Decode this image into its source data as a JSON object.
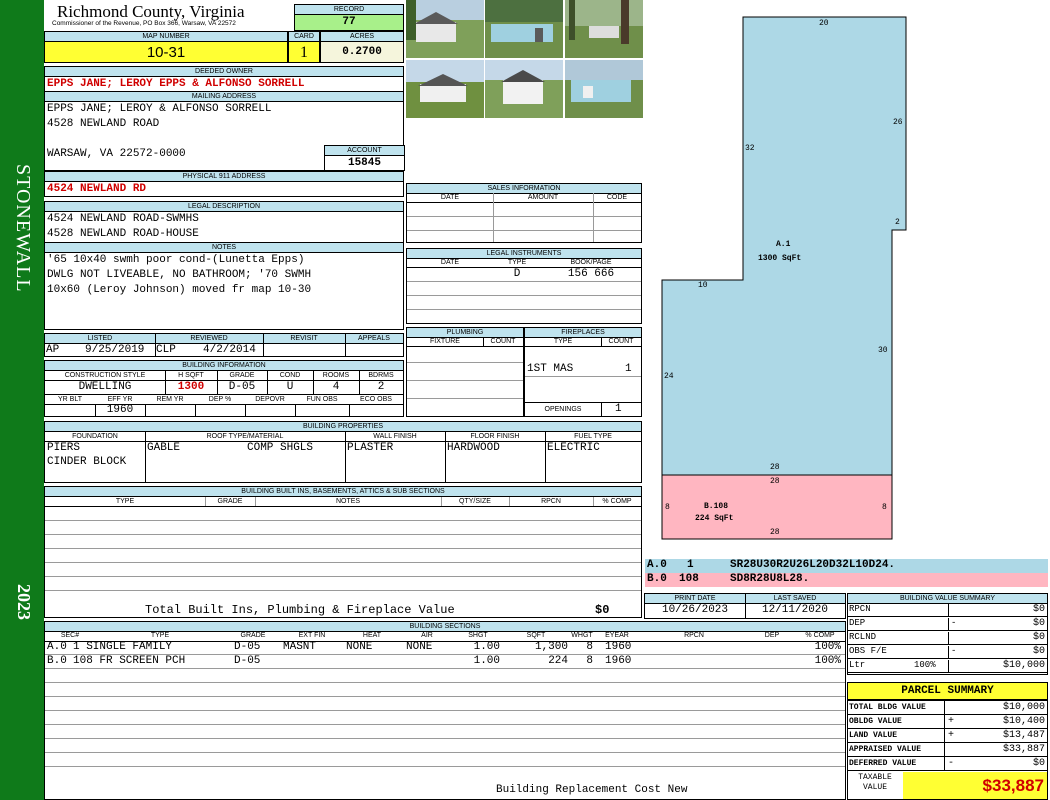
{
  "sidebar": {
    "name": "STONEWALL",
    "year": "2023"
  },
  "header": {
    "county": "Richmond County, Virginia",
    "commissioner": "Commissioner of the Revenue, PO Box 366, Warsaw, VA 22572",
    "record_label": "RECORD",
    "record": "77",
    "map_label": "MAP NUMBER",
    "map_number": "10-31",
    "card_label": "CARD",
    "card": "1",
    "acres_label": "ACRES",
    "acres": "0.2700"
  },
  "owner": {
    "deeded_label": "DEEDED OWNER",
    "deeded": "EPPS JANE; LEROY EPPS & ALFONSO SORRELL",
    "mailing_label": "MAILING ADDRESS",
    "mailing": [
      "EPPS JANE; LEROY & ALFONSO SORRELL",
      "4528 NEWLAND ROAD",
      "",
      "WARSAW, VA 22572-0000"
    ],
    "account_label": "ACCOUNT",
    "account": "15845",
    "physical_label": "PHYSICAL 911 ADDRESS",
    "physical": "4524 NEWLAND RD"
  },
  "legal": {
    "label": "LEGAL DESCRIPTION",
    "lines": [
      "4524 NEWLAND ROAD-SWMHS",
      "4528 NEWLAND ROAD-HOUSE"
    ]
  },
  "notes": {
    "label": "NOTES",
    "lines": [
      "'65 10x40 swmh poor cond-(Lunetta Epps)",
      "DWLG NOT LIVEABLE, NO BATHROOM; '70 SWMH",
      "10x60 (Leroy Johnson) moved fr map 10-30"
    ]
  },
  "review": {
    "listed_label": "LISTED",
    "reviewed_label": "REVIEWED",
    "revisit_label": "REVISIT",
    "appeals_label": "APPEALS",
    "listed_by": "AP",
    "listed_date": "9/25/2019",
    "reviewed_by": "CLP",
    "reviewed_date": "4/2/2014"
  },
  "building_info": {
    "label": "BUILDING INFORMATION",
    "headers": [
      "CONSTRUCTION STYLE",
      "H SQFT",
      "GRADE",
      "COND",
      "ROOMS",
      "BDRMS"
    ],
    "style": "DWELLING",
    "hsqft": "1300",
    "grade": "D-05",
    "cond": "U",
    "rooms": "4",
    "bdrms": "2",
    "headers2": [
      "YR BLT",
      "EFF YR",
      "REM YR",
      "DEP %",
      "DEPOVR",
      "FUN OBS",
      "ECO OBS"
    ],
    "eff_yr": "1960"
  },
  "sales": {
    "label": "SALES INFORMATION",
    "headers": [
      "DATE",
      "AMOUNT",
      "CODE"
    ]
  },
  "instruments": {
    "label": "LEGAL INSTRUMENTS",
    "headers": [
      "DATE",
      "TYPE",
      "BOOK/PAGE"
    ],
    "type": "D",
    "bookpage": "156 666"
  },
  "plumbing": {
    "label": "PLUMBING",
    "headers": [
      "FIXTURE",
      "COUNT"
    ]
  },
  "fireplaces": {
    "label": "FIREPLACES",
    "headers": [
      "TYPE",
      "COUNT"
    ],
    "type": "1ST MAS",
    "count": "1",
    "openings_label": "OPENINGS",
    "openings": "1"
  },
  "properties": {
    "label": "BUILDING PROPERTIES",
    "headers": [
      "FOUNDATION",
      "ROOF TYPE/MATERIAL",
      "WALL FINISH",
      "FLOOR FINISH",
      "FUEL TYPE"
    ],
    "foundation": [
      "PIERS",
      "CINDER BLOCK"
    ],
    "roof_type": "GABLE",
    "roof_material": "COMP SHGLS",
    "wall": "PLASTER",
    "floor": "HARDWOOD",
    "fuel": "ELECTRIC"
  },
  "builtins": {
    "label": "BUILDING BUILT INS, BASEMENTS, ATTICS & SUB SECTIONS",
    "headers": [
      "TYPE",
      "GRADE",
      "NOTES",
      "QTY/SIZE",
      "RPCN",
      "% COMP"
    ],
    "total_label": "Total Built Ins, Plumbing & Fireplace Value",
    "total": "$0"
  },
  "sketch": {
    "a_label": "A.1",
    "a_area": "1300 SqFt",
    "b_label": "B.108",
    "b_area": "224 SqFt",
    "dims": {
      "top": "20",
      "right_upper": "26",
      "left_upper": "32",
      "notch": "2",
      "step": "10",
      "right_lower": "30",
      "left_lower": "24",
      "mid": "28",
      "b_top": "28",
      "b_left": "8",
      "b_right": "8",
      "b_bottom": "28"
    },
    "codes": [
      {
        "id": "A.0",
        "n": "1",
        "code": "SR28U30R2U26L20D32L10D24."
      },
      {
        "id": "B.0",
        "n": "108",
        "code": "SD8R28U8L28."
      }
    ]
  },
  "dates": {
    "print_label": "PRINT DATE",
    "print": "10/26/2023",
    "saved_label": "LAST SAVED",
    "saved": "12/11/2020"
  },
  "value_summary": {
    "label": "BUILDING VALUE SUMMARY",
    "rows": [
      {
        "label": "RPCN",
        "sign": "",
        "value": "$0"
      },
      {
        "label": "DEP",
        "sign": "-",
        "value": "$0"
      },
      {
        "label": "RCLND",
        "sign": "",
        "value": "$0"
      },
      {
        "label": "OBS F/E",
        "sign": "-",
        "value": "$0"
      },
      {
        "label": "Ltr",
        "sign": "100%",
        "value": "$10,000"
      }
    ]
  },
  "parcel_summary": {
    "label": "PARCEL SUMMARY",
    "rows": [
      {
        "label": "TOTAL BLDG VALUE",
        "sign": "",
        "value": "$10,000"
      },
      {
        "label": "OBLDG VALUE",
        "sign": "+",
        "value": "$10,400"
      },
      {
        "label": "LAND VALUE",
        "sign": "+",
        "value": "$13,487"
      },
      {
        "label": "APPRAISED VALUE",
        "sign": "",
        "value": "$33,887"
      },
      {
        "label": "DEFERRED VALUE",
        "sign": "-",
        "value": "$0"
      }
    ],
    "taxable_label1": "TAXABLE",
    "taxable_label2": "VALUE",
    "taxable": "$33,887"
  },
  "sections": {
    "label": "BUILDING SECTIONS",
    "headers": [
      "SEC#",
      "TYPE",
      "GRADE",
      "EXT FIN",
      "HEAT",
      "AIR",
      "SHGT",
      "SQFT",
      "WHGT",
      "EYEAR",
      "RPCN",
      "DEP",
      "% COMP"
    ],
    "rows": [
      {
        "sec": "A.0",
        "type": "1 SINGLE FAMILY",
        "grade": "D-05",
        "ext": "MASNT",
        "heat": "NONE",
        "air": "NONE",
        "shgt": "1.00",
        "sqft": "1,300",
        "whgt": "8",
        "eyear": "1960",
        "comp": "100%"
      },
      {
        "sec": "B.0",
        "type": "108 FR SCREEN PCH",
        "grade": "D-05",
        "ext": "",
        "heat": "",
        "air": "",
        "shgt": "1.00",
        "sqft": "224",
        "whgt": "8",
        "eyear": "1960",
        "comp": "100%"
      }
    ],
    "footer": "Building Replacement Cost New"
  },
  "colors": {
    "sidebar": "#0f7a1a",
    "header_band": "#bfe3ee",
    "yellow": "#ffff33",
    "green": "#a8f08a",
    "sketch_a": "#add8e6",
    "sketch_b": "#ffb6c1",
    "red": "#d00000"
  }
}
